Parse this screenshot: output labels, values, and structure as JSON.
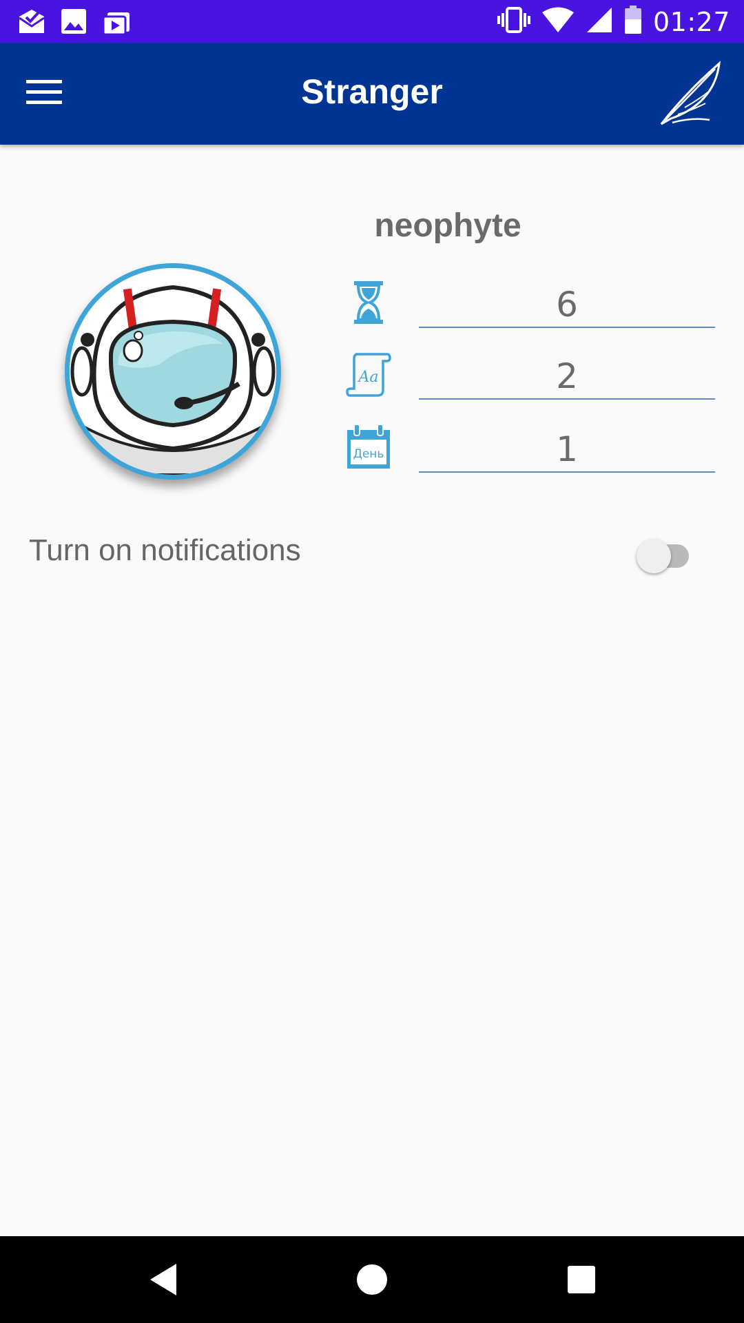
{
  "status_bar": {
    "time": "01:27",
    "left_icons": [
      "mail-check-icon",
      "image-icon",
      "shopping-bag-icon"
    ],
    "right_icons": [
      "vibrate-icon",
      "wifi-icon",
      "signal-icon",
      "battery-icon"
    ]
  },
  "app_bar": {
    "title": "Stranger",
    "menu_icon": "hamburger-menu-icon",
    "action_icon": "quill-pen-icon"
  },
  "profile": {
    "avatar_icon": "astronaut-helmet-avatar",
    "rank": "neophyte",
    "stats": [
      {
        "icon": "hourglass-icon",
        "value": "6"
      },
      {
        "icon": "scroll-icon",
        "icon_text": "Aa",
        "value": "2"
      },
      {
        "icon": "calendar-day-icon",
        "icon_text": "День",
        "value": "1"
      }
    ]
  },
  "notifications": {
    "label": "Turn on notifications",
    "enabled": false
  },
  "colors": {
    "status_bar": "#4a14e0",
    "app_bar": "#023593",
    "accent": "#3fa5d9",
    "background": "#fafafa"
  },
  "nav_bar": {
    "buttons": [
      "back-icon",
      "home-icon",
      "recents-icon"
    ]
  }
}
